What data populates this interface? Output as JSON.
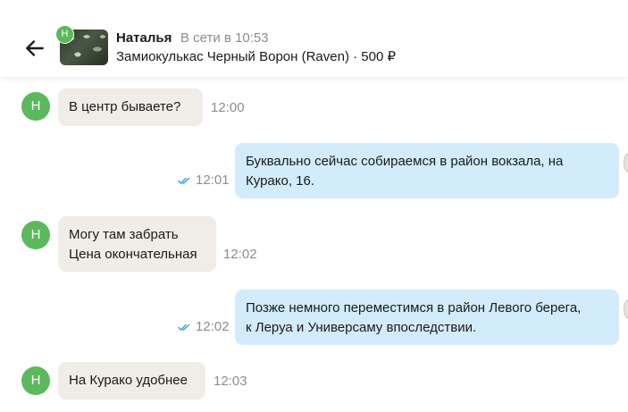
{
  "header": {
    "name": "Наталья",
    "status": "В сети в 10:53",
    "listing": "Замиокулькас Черный Ворон (Raven) · 500 ₽",
    "avatar_letter": "Н"
  },
  "messages": [
    {
      "direction": "in",
      "avatar_letter": "Н",
      "text": "В центр  бываете?",
      "time": "12:00"
    },
    {
      "direction": "out",
      "text": "Буквально сейчас собираемся в район вокзала, на\nКурако, 16.",
      "time": "12:01",
      "read": true
    },
    {
      "direction": "in",
      "avatar_letter": "Н",
      "text": "Могу там забрать\nЦена окончательная",
      "time": "12:02"
    },
    {
      "direction": "out",
      "text": "Позже немного переместимся в район Левого берега,\nк Леруа и Универсаму впоследствии.",
      "time": "12:02",
      "read": true
    },
    {
      "direction": "in",
      "avatar_letter": "Н",
      "text": "На Курако удобнее",
      "time": "12:03"
    }
  ],
  "colors": {
    "avatar": "#5cb85c",
    "incoming_bubble": "#f0ede8",
    "outgoing_bubble": "#d2ecfb",
    "read_ticks": "#3aa0d8",
    "muted_text": "#8c8c8c"
  }
}
